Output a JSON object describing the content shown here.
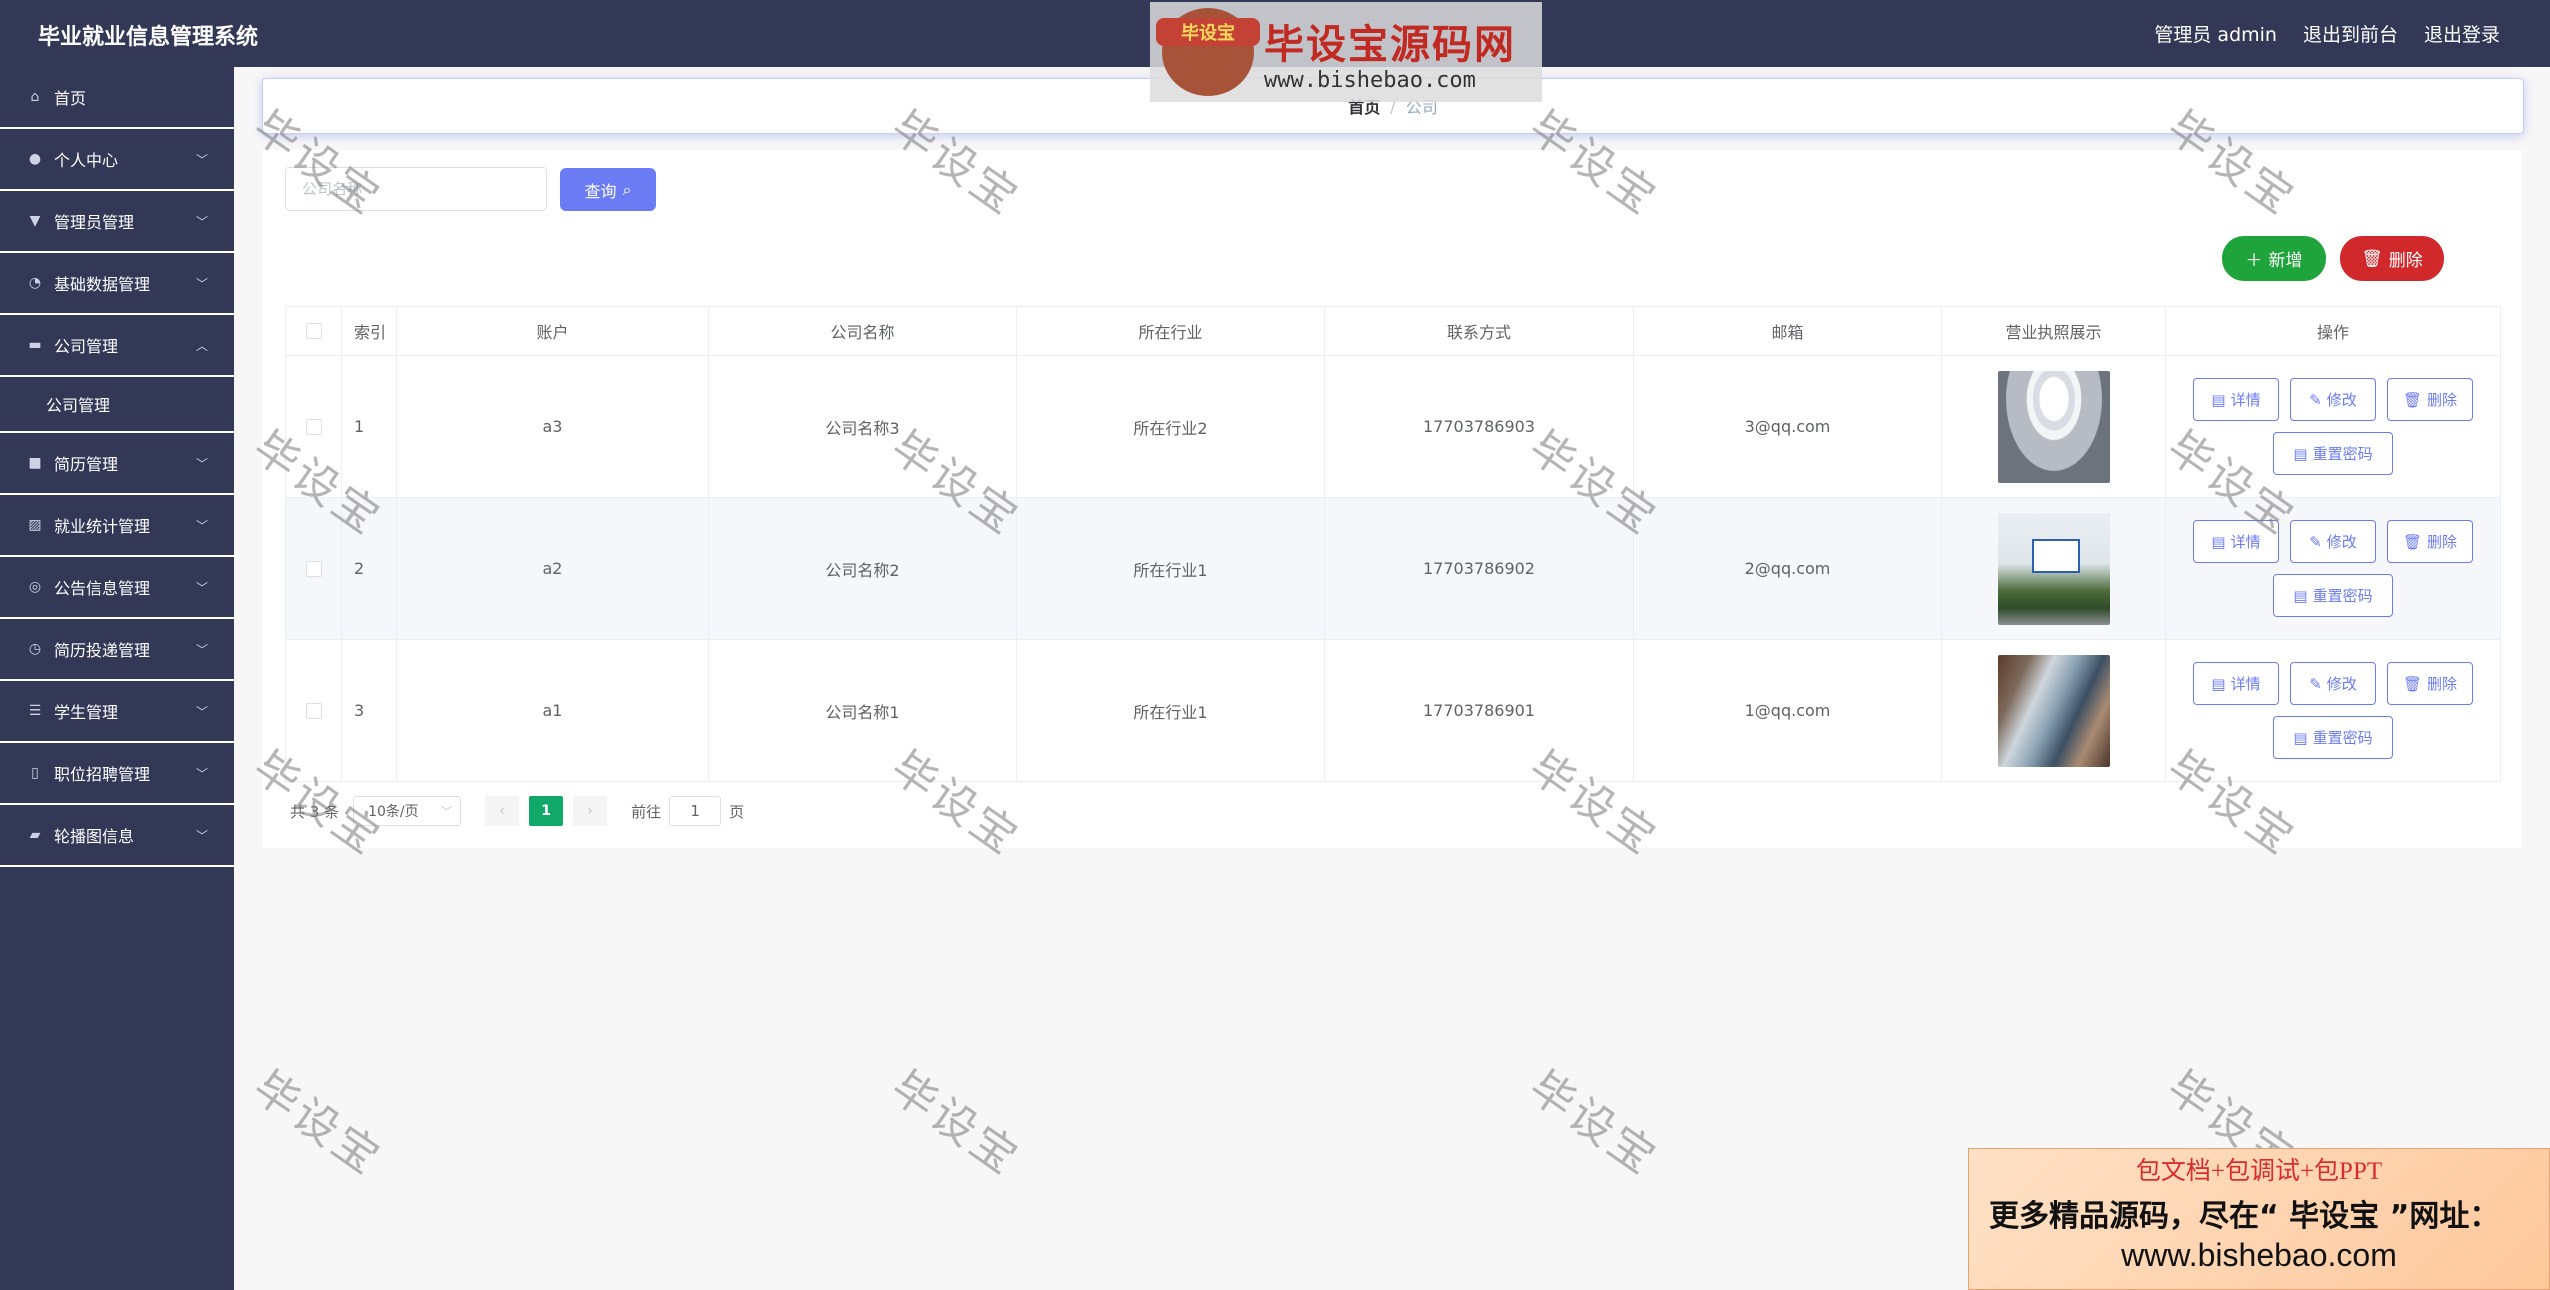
{
  "app": {
    "title": "毕业就业信息管理系统"
  },
  "header": {
    "user": "管理员 admin",
    "to_front": "退出到前台",
    "logout": "退出登录"
  },
  "sidebar": {
    "home": "首页",
    "items": [
      {
        "label": "个人中心",
        "icon": "user-icon"
      },
      {
        "label": "管理员管理",
        "icon": "admin-icon"
      },
      {
        "label": "基础数据管理",
        "icon": "bell-off-icon"
      },
      {
        "label": "公司管理",
        "icon": "monitor-icon",
        "expanded": true,
        "sub": "公司管理"
      },
      {
        "label": "简历管理",
        "icon": "briefcase-icon"
      },
      {
        "label": "就业统计管理",
        "icon": "chart-icon"
      },
      {
        "label": "公告信息管理",
        "icon": "bulb-icon"
      },
      {
        "label": "简历投递管理",
        "icon": "compass-icon"
      },
      {
        "label": "学生管理",
        "icon": "list-icon"
      },
      {
        "label": "职位招聘管理",
        "icon": "mic-icon"
      },
      {
        "label": "轮播图信息",
        "icon": "ticket-icon"
      }
    ]
  },
  "breadcrumb": {
    "home": "首页",
    "sep": "/",
    "current": "公司"
  },
  "search": {
    "placeholder": "公司名称",
    "button": "查询"
  },
  "actions": {
    "add": "新增",
    "delete": "删除"
  },
  "table": {
    "headers": [
      "索引",
      "账户",
      "公司名称",
      "所在行业",
      "联系方式",
      "邮箱",
      "营业执照展示",
      "操作"
    ],
    "rows": [
      {
        "index": "1",
        "account": "a3",
        "name": "公司名称3",
        "industry": "所在行业2",
        "phone": "17703786903",
        "email": "3@qq.com"
      },
      {
        "index": "2",
        "account": "a2",
        "name": "公司名称2",
        "industry": "所在行业1",
        "phone": "17703786902",
        "email": "2@qq.com"
      },
      {
        "index": "3",
        "account": "a1",
        "name": "公司名称1",
        "industry": "所在行业1",
        "phone": "17703786901",
        "email": "1@qq.com"
      }
    ],
    "ops": {
      "detail": "详情",
      "edit": "修改",
      "delete": "删除",
      "reset": "重置密码"
    }
  },
  "pagination": {
    "total": "共 3 条",
    "page_size": "10条/页",
    "current": "1",
    "goto_prefix": "前往",
    "goto_value": "1",
    "goto_suffix": "页"
  },
  "watermark": {
    "logo_badge": "毕设宝",
    "logo_text": "毕设宝源码网",
    "logo_url": "www.bishebao.com",
    "stamp": "毕设宝"
  },
  "ad": {
    "line1": "包文档+包调试+包PPT",
    "line2": "更多精品源码，尽在“ 毕设宝 ”网址：",
    "line3": "www.bishebao.com"
  },
  "colors": {
    "sidebar_bg": "#333856",
    "primary": "#6b7bf4",
    "success": "#1fa33b",
    "danger": "#d1282c",
    "page_active": "#11a96a"
  }
}
